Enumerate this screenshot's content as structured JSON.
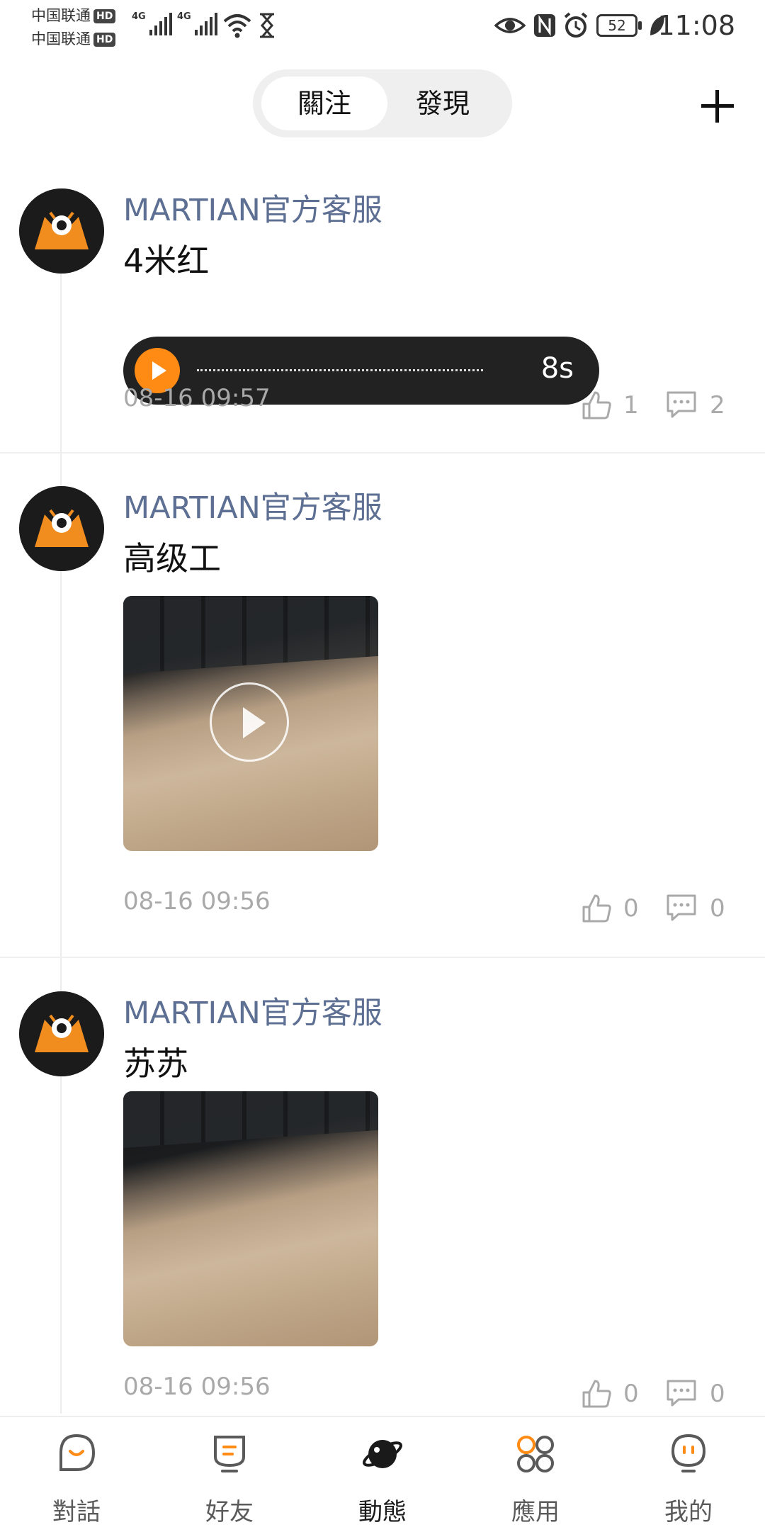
{
  "status_bar": {
    "carrier1": "中国联通",
    "carrier2": "中国联通",
    "hd_badge": "HD",
    "network1": "4G",
    "network2": "4G",
    "battery": "52",
    "time": "11:08"
  },
  "header": {
    "tabs": [
      {
        "label": "關注",
        "active": true
      },
      {
        "label": "發現",
        "active": false
      }
    ]
  },
  "feed": [
    {
      "author": "MARTIAN官方客服",
      "text": "4米红",
      "media": {
        "type": "voice",
        "duration": "8s"
      },
      "time": "08-16 09:57",
      "likes": "1",
      "comments": "2"
    },
    {
      "author": "MARTIAN官方客服",
      "text": "高级工",
      "media": {
        "type": "video"
      },
      "time": "08-16 09:56",
      "likes": "0",
      "comments": "0"
    },
    {
      "author": "MARTIAN官方客服",
      "text": "苏苏",
      "media": {
        "type": "image"
      },
      "time": "08-16 09:56",
      "likes": "0",
      "comments": "0"
    }
  ],
  "bottom_nav": [
    {
      "label": "對話",
      "icon": "chat-bubble-icon",
      "active": false
    },
    {
      "label": "好友",
      "icon": "friend-icon",
      "active": false
    },
    {
      "label": "動態",
      "icon": "planet-icon",
      "active": true
    },
    {
      "label": "應用",
      "icon": "apps-icon",
      "active": false
    },
    {
      "label": "我的",
      "icon": "profile-icon",
      "active": false
    }
  ],
  "colors": {
    "accent": "#ff8a14",
    "author": "#5d6f92",
    "meta": "#a9a9a9"
  }
}
